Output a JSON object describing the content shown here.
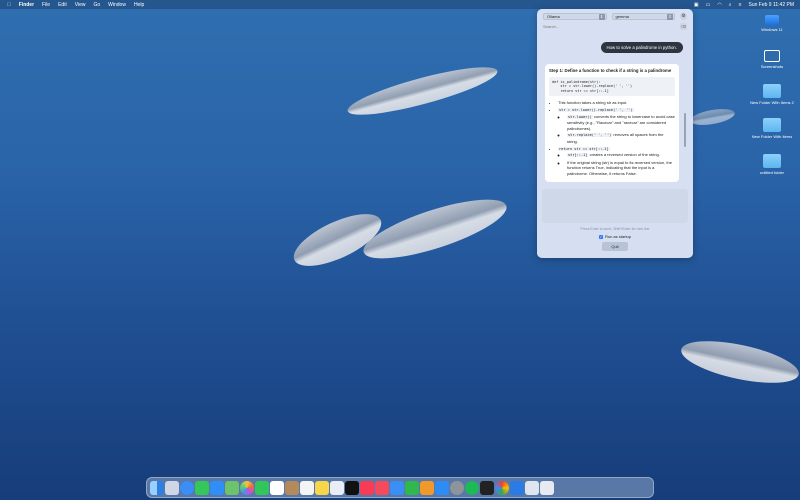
{
  "menubar": {
    "apple": "",
    "app_name": "Finder",
    "items": [
      "File",
      "Edit",
      "View",
      "Go",
      "Window",
      "Help"
    ],
    "datetime": "Sun Feb 9  11:42 PM"
  },
  "desktop_icons": [
    {
      "label": "Windows 11",
      "icon": "drive-icon"
    },
    {
      "label": "Screenshots",
      "icon": "folder-icon"
    },
    {
      "label": "New Folder With Items 2",
      "icon": "folder-icon"
    },
    {
      "label": "New Folder With Items",
      "icon": "folder-icon"
    },
    {
      "label": "untitled folder",
      "icon": "folder-icon"
    }
  ],
  "panel": {
    "provider": "Ollama",
    "model": "gemma",
    "search_placeholder": "Search...",
    "user_message": "How to solve a palindrome in python.",
    "answer": {
      "title": "Step 1: Define a function to check if a string is a palindrome",
      "code": "def is_palindrome(str):\n    str = str.lower().replace(' ', '')\n    return str == str[::-1]",
      "b1": "This function takes a string str as input.",
      "b2_code": "str = str.lower().replace(' ', '')",
      "b2a_code": "str.lower()",
      "b2a_text": "converts the string to lowercase to avoid case sensitivity (e.g., \"Racecar\" and \"racecar\" are considered palindromes).",
      "b2b_code": "str.replace(' ', '')",
      "b2b_text": "removes all spaces from the string.",
      "b3_code": "return str == str[::-1]",
      "b3a_code": "str[::-1]",
      "b3a_text": "creates a reversed version of the string.",
      "b3b_text": "If the original string (str) is equal to its reversed version, the function returns True, indicating that the input is a palindrome. Otherwise, it returns False."
    },
    "hint": "Press Enter to send, Shift+Enter for new line",
    "startup_label": "Run as startup",
    "startup_checked": true,
    "quit_label": "Quit"
  },
  "dock": {
    "apps": [
      "finder",
      "launchpad",
      "safari",
      "messages",
      "mail",
      "maps",
      "photos",
      "facetime",
      "calendar",
      "contacts",
      "reminders",
      "notes",
      "freeform",
      "tv",
      "music",
      "news",
      "keynote",
      "numbers",
      "pages",
      "app-store",
      "system-settings",
      "spotify",
      "terminal",
      "chrome",
      "xcode",
      "preview",
      "trash"
    ]
  },
  "colors": {
    "accent": "#2a7cf6",
    "panel": "#e1e8f6",
    "user_bubble": "#2e3440"
  }
}
